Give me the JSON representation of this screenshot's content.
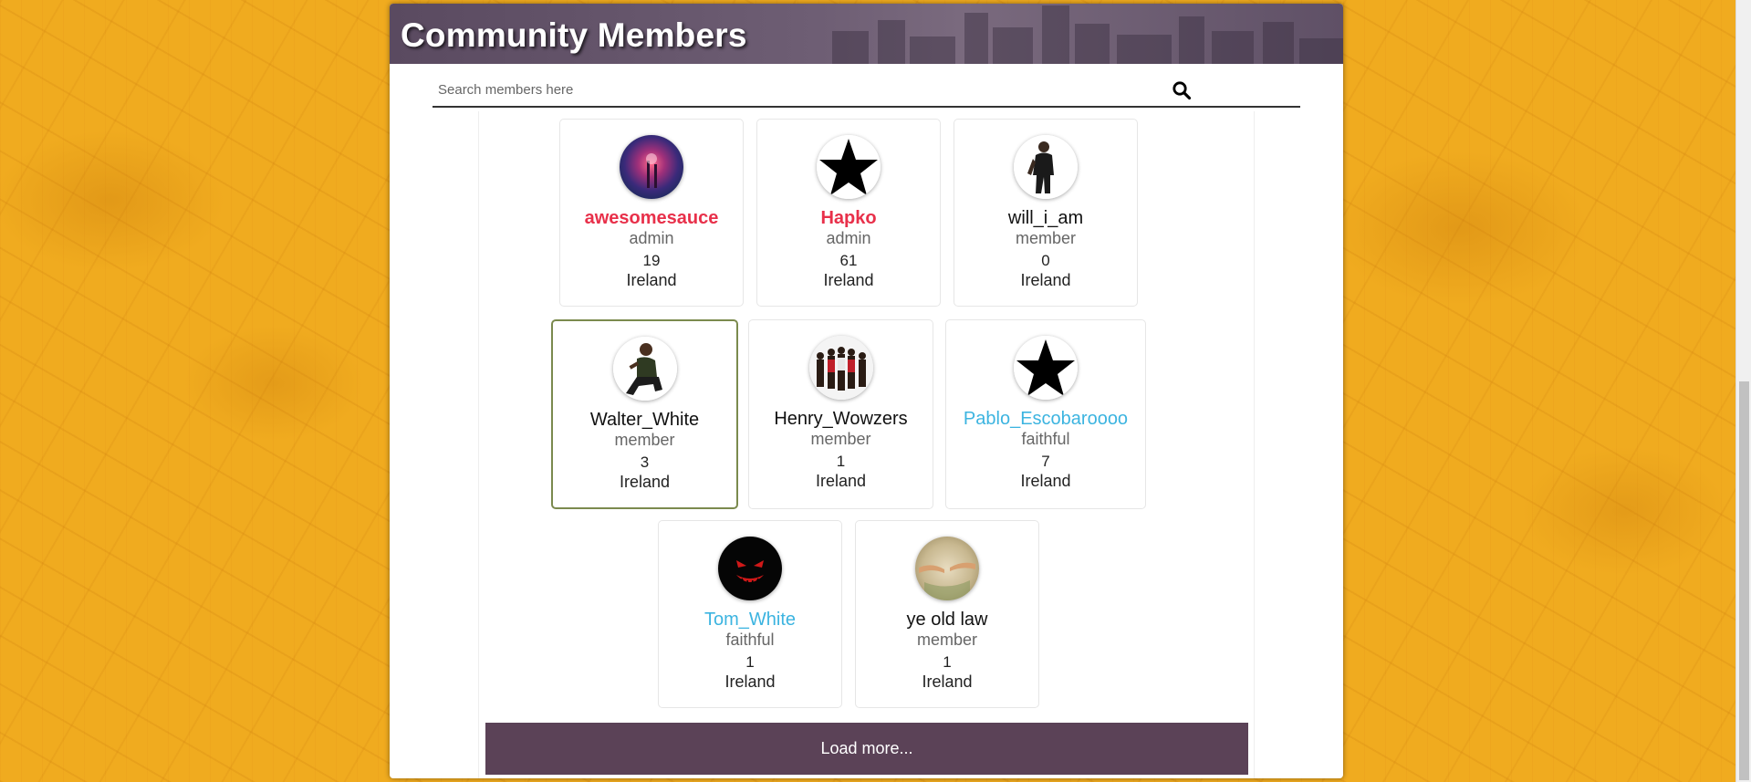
{
  "header": {
    "title": "Community Members"
  },
  "search": {
    "placeholder": "Search members here",
    "icon": "search-icon"
  },
  "members": [
    {
      "name": "awesomesauce",
      "rank": "admin",
      "count": "19",
      "country": "Ireland",
      "avatar": "galaxy-avatar"
    },
    {
      "name": "Hapko",
      "rank": "admin",
      "count": "61",
      "country": "Ireland",
      "avatar": "star-avatar"
    },
    {
      "name": "will_i_am",
      "rank": "member",
      "count": "0",
      "country": "Ireland",
      "avatar": "figure-avatar"
    },
    {
      "name": "Walter_White",
      "rank": "member",
      "count": "3",
      "country": "Ireland",
      "avatar": "seated-figure-avatar"
    },
    {
      "name": "Henry_Wowzers",
      "rank": "member",
      "count": "1",
      "country": "Ireland",
      "avatar": "group-avatar"
    },
    {
      "name": "Pablo_Escobaroooo",
      "rank": "faithful",
      "count": "7",
      "country": "Ireland",
      "avatar": "star-avatar"
    },
    {
      "name": "Tom_White",
      "rank": "faithful",
      "count": "1",
      "country": "Ireland",
      "avatar": "red-face-avatar"
    },
    {
      "name": "ye old law",
      "rank": "member",
      "count": "1",
      "country": "Ireland",
      "avatar": "painting-avatar"
    }
  ],
  "load_more": {
    "label": "Load more..."
  },
  "colors": {
    "admin": "#e8304a",
    "faithful": "#3cb4e0",
    "member": "#111111",
    "button": "#5b4257",
    "background": "#f0ab1f"
  }
}
